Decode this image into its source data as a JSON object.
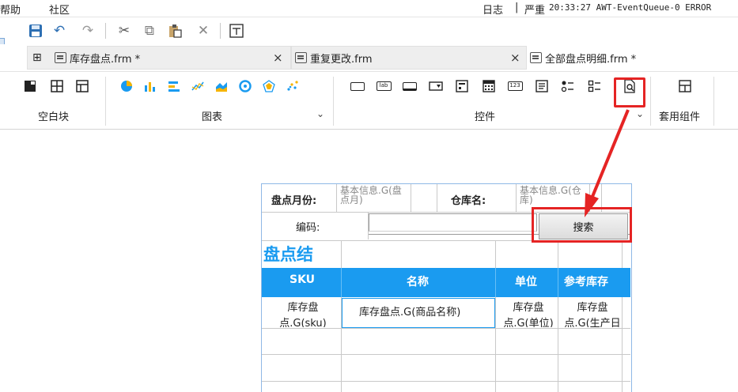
{
  "menu": {
    "help": "帮助",
    "community": "社区"
  },
  "status": {
    "log": "日志",
    "severity": "严重",
    "message": "20:33:27 AWT-EventQueue-0 ERROR"
  },
  "tabs": [
    {
      "label": "库存盘点.frm *"
    },
    {
      "label": "重复更改.frm"
    },
    {
      "label": "全部盘点明细.frm *"
    }
  ],
  "ribbon": {
    "groups": {
      "blank": "空白块",
      "chart": "图表",
      "widget": "控件",
      "component": "套用组件"
    },
    "widget_icons": {
      "label": "lab",
      "number": "123"
    }
  },
  "form": {
    "month_label": "盘点月份:",
    "month_field": "基本信息.G(盘点月)",
    "warehouse_label": "仓库名:",
    "warehouse_field": "基本信息.G(仓库)",
    "code_label": "编码:",
    "search_button": "搜索",
    "result_title": "盘点结",
    "columns": [
      "SKU",
      "名称",
      "单位",
      "参考库存"
    ],
    "row1": [
      "库存盘点.G(sku)",
      "库存盘点.G(商品名称)",
      "库存盘点.G(单位)",
      "库存盘点.G(生产日"
    ]
  },
  "colors": {
    "accent": "#1a9bf0",
    "highlight": "#e52424"
  }
}
